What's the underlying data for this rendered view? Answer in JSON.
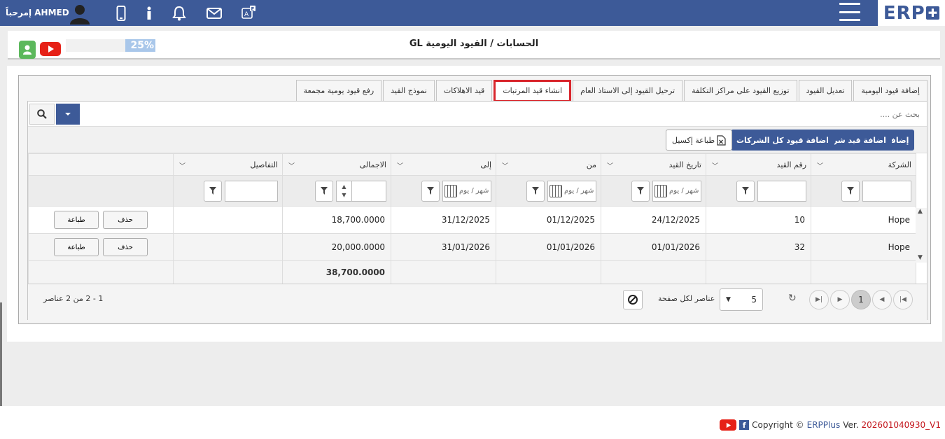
{
  "header": {
    "greeting": "إمرحباً AHMED",
    "logo": "ERP"
  },
  "title_bar": {
    "title": "الحسابات / القيود اليومية GL",
    "progress_text": "25%",
    "progress_value": 0.25
  },
  "tabs": [
    {
      "label": "إضافة قيود اليومية"
    },
    {
      "label": "تعديل القيود"
    },
    {
      "label": "توزيع القيود على مراكز التكلفة"
    },
    {
      "label": "ترحيل القيود إلى الاستاذ العام"
    },
    {
      "label": "انشاء قيد المرتبات"
    },
    {
      "label": "قيد الاهلاكات"
    },
    {
      "label": "نموذج القيد"
    },
    {
      "label": "رفع قيود يومية مجمعة"
    }
  ],
  "search": {
    "placeholder": "بحث عن ...."
  },
  "toolbar": {
    "add": "إضافة",
    "add_company": "اضافة قيد شركة",
    "add_all_companies": "اضافة قيود كل الشركات",
    "print_excel": "طباعة إكسيل"
  },
  "columns": {
    "company": "الشركة",
    "entry_no": "رقم القيد",
    "entry_date": "تاريخ القيد",
    "from": "من",
    "to": "إلى",
    "total": "الاجمالى",
    "details": "التفاصيل"
  },
  "filters": {
    "date_placeholder": "شهر / يوم"
  },
  "rows": [
    {
      "company": "Hope",
      "entry_no": "10",
      "entry_date": "24/12/2025",
      "from": "01/12/2025",
      "to": "31/12/2025",
      "total": "18,700.0000",
      "delete": "حذف",
      "print": "طباعة"
    },
    {
      "company": "Hope",
      "entry_no": "32",
      "entry_date": "01/01/2026",
      "from": "01/01/2026",
      "to": "31/01/2026",
      "total": "20,000.0000",
      "delete": "حذف",
      "print": "طباعة"
    }
  ],
  "totals": {
    "total": "38,700.0000"
  },
  "pager": {
    "current_page": "1",
    "page_size": "5",
    "page_size_label": "عناصر لكل صفحة",
    "info": "1 - 2 من 2 عناصر"
  },
  "footer": {
    "copyright": "Copyright ©",
    "brand": "ERPPlus",
    "ver_label": "Ver.",
    "version": "202601040930_V1"
  },
  "colors": {
    "primary": "#3d5a98",
    "active_tab_border": "#d9262c",
    "youtube": "#e62117",
    "green": "#5cb85c"
  }
}
